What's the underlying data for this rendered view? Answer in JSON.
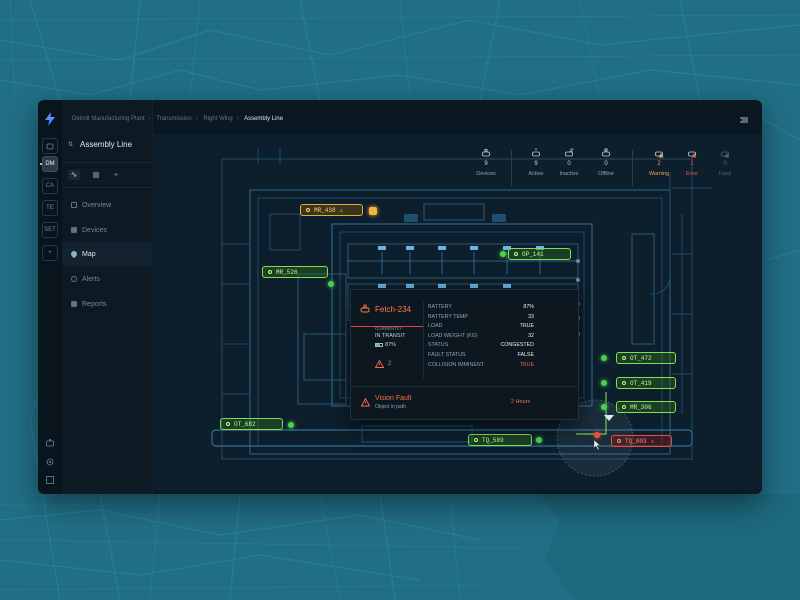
{
  "breadcrumb": [
    "Detroit Manufacturing Plant",
    "Transmission",
    "Right Wing",
    "Assembly Line"
  ],
  "rail": {
    "items": [
      "DM",
      "CA",
      "TE",
      "SET",
      "+"
    ]
  },
  "sidebar": {
    "title": "Assembly Line",
    "nav": [
      {
        "label": "Overview",
        "active": false
      },
      {
        "label": "Devices",
        "active": false
      },
      {
        "label": "Map",
        "active": true
      },
      {
        "label": "Alerts",
        "active": false
      },
      {
        "label": "Reports",
        "active": false
      }
    ]
  },
  "stats": [
    {
      "label": "Devices",
      "value": "9",
      "kind": "normal",
      "icon": "robot-icon"
    },
    {
      "label": "Active",
      "value": "9",
      "kind": "normal",
      "icon": "robot-active-icon"
    },
    {
      "label": "Inactive",
      "value": "0",
      "kind": "normal",
      "icon": "robot-inactive-icon"
    },
    {
      "label": "Offline",
      "value": "0",
      "kind": "normal",
      "icon": "robot-offline-icon"
    },
    {
      "label": "Warning",
      "value": "2",
      "kind": "warn",
      "icon": "robot-warning-icon"
    },
    {
      "label": "Error",
      "value": "1",
      "kind": "err",
      "icon": "robot-error-icon"
    },
    {
      "label": "Fatal",
      "value": "0",
      "kind": "fatal",
      "icon": "robot-fatal-icon"
    }
  ],
  "tags": {
    "mr438": "MR_438",
    "mr526": "MR_526",
    "op141": "OP_141",
    "ot682": "OT_682",
    "ot472": "OT_472",
    "ot419": "OT_419",
    "mr306": "MR_306",
    "tq589": "TQ_589",
    "tq003": "TQ_003"
  },
  "popup": {
    "name": "Fetch-234",
    "status_label": "CURRENTLY",
    "status_value": "IN TRANSIT",
    "battery": "87%",
    "alerts": "2",
    "details": [
      {
        "key": "BATTERY",
        "value": "87%",
        "red": false
      },
      {
        "key": "BATTERY TEMP",
        "value": "33",
        "red": false
      },
      {
        "key": "LOAD",
        "value": "TRUE",
        "red": false
      },
      {
        "key": "LOAD WEIGHT (KG)",
        "value": "32",
        "red": false
      },
      {
        "key": "STATUS",
        "value": "CONGESTED",
        "red": false
      },
      {
        "key": "FAULT STATUS",
        "value": "FALSE",
        "red": false
      },
      {
        "key": "COLLISION IMMINENT",
        "value": "TRUE",
        "red": true
      }
    ],
    "fault_title": "Vision Fault",
    "fault_sub": "Object in path",
    "fault_time": "2 Hours"
  },
  "colors": {
    "accent_green": "#7ee04a",
    "warning": "#f3a64c",
    "error": "#f0574a",
    "background_map": "#1f6f85"
  }
}
